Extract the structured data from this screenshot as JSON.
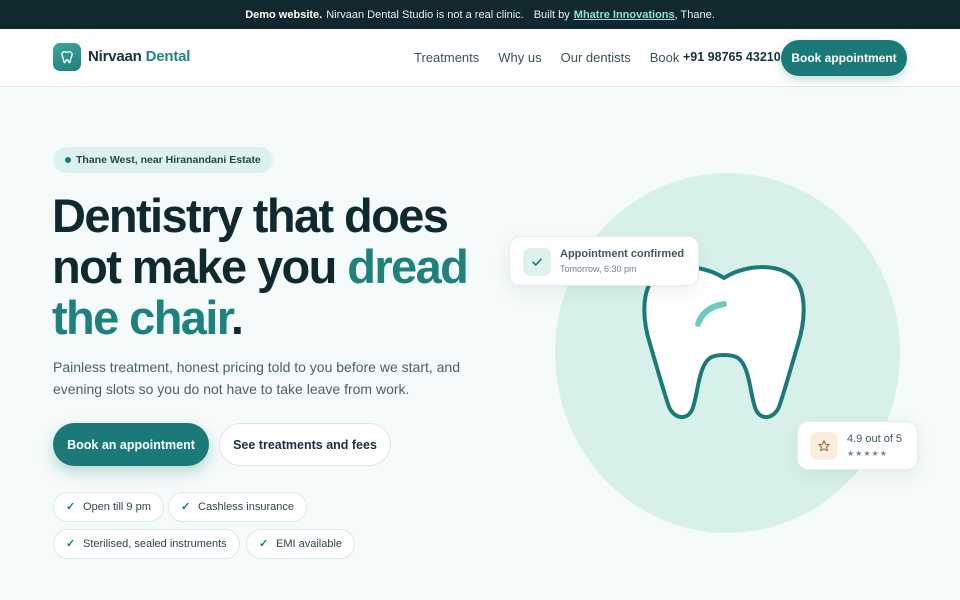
{
  "demo_banner": {
    "strong": "Demo website.",
    "text": "Nirvaan Dental Studio is not a real clinic.",
    "built_by_prefix": "Built by",
    "maker": "Mhatre Innovations",
    "suffix": ", Thane."
  },
  "header": {
    "logo_icon": "tooth-icon",
    "brand_primary": "Nirvaan",
    "brand_accent": "Dental",
    "nav": [
      "Treatments",
      "Why us",
      "Our dentists",
      "Book"
    ],
    "phone": "+91 98765 43210",
    "cta": "Book appointment"
  },
  "hero": {
    "location": "Thane West, near Hiranandani Estate",
    "headline_line1": "Dentistry that does",
    "headline_line2_plain": "not make you",
    "headline_line2_accent": "dread",
    "headline_line3_accent": "the chair",
    "headline_line3_end": ".",
    "subtitle": "Painless treatment, honest pricing told to you before we start, and evening slots so you do not have to take leave from work.",
    "primary_button": "Book an appointment",
    "secondary_button": "See treatments and fees",
    "features": [
      "Open till 9 pm",
      "Cashless insurance",
      "Sterilised, sealed instruments",
      "EMI available"
    ]
  },
  "visual": {
    "appointment_title": "Appointment confirmed",
    "appointment_time": "Tomorrow, 6:30 pm",
    "rating_text": "4.9 out of 5",
    "rating_stars": "★★★★★",
    "rating_value": 4.9,
    "icons": [
      "check-icon",
      "star-icon"
    ]
  },
  "colors": {
    "brand": "#1b7a77",
    "accent_text": "#1f817c",
    "dark": "#11292e",
    "mint": "#d7f0ea"
  }
}
